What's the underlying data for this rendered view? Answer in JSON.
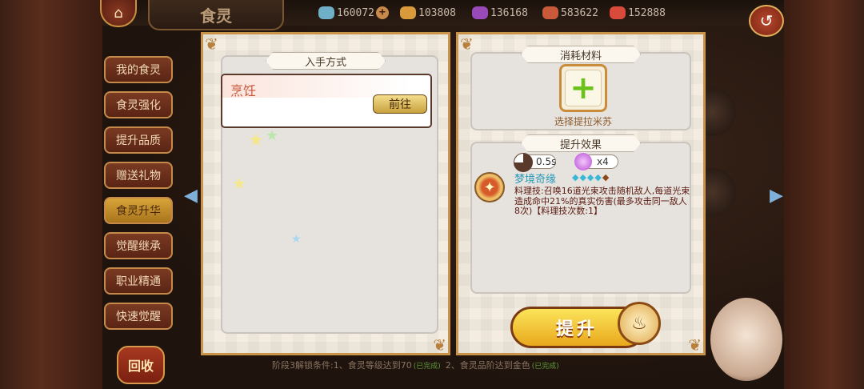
{
  "header": {
    "title": "食灵",
    "home_icon": "⌂",
    "back_icon": "↺"
  },
  "resources": [
    {
      "name": "diamond",
      "value": "160072",
      "color": "#6fb0c8",
      "has_plus": true
    },
    {
      "name": "gold",
      "value": "103808",
      "color": "#d89a3a",
      "has_plus": false
    },
    {
      "name": "crystal",
      "value": "136168",
      "color": "#9a4ab8",
      "has_plus": false
    },
    {
      "name": "meat",
      "value": "583622",
      "color": "#c85a3a",
      "has_plus": false
    },
    {
      "name": "cake",
      "value": "152888",
      "color": "#d84a3a",
      "has_plus": false
    }
  ],
  "sidebar": {
    "items": [
      {
        "label": "我的食灵"
      },
      {
        "label": "食灵强化"
      },
      {
        "label": "提升品质"
      },
      {
        "label": "赠送礼物"
      },
      {
        "label": "食灵升华"
      },
      {
        "label": "觉醒继承"
      },
      {
        "label": "职业精通"
      },
      {
        "label": "快速觉醒"
      }
    ],
    "active_index": 4,
    "recycle_label": "回收"
  },
  "left_panel": {
    "section_title": "入手方式",
    "source_name": "烹饪",
    "goto_label": "前往"
  },
  "right_panel": {
    "materials_title": "消耗材料",
    "slot_label": "选择提拉米苏",
    "effect_title": "提升效果",
    "cooldown": "0.5s",
    "energy": "x4",
    "skill_name": "梦境奇缘",
    "gems": "◆◆◆◆",
    "gem_last": "◆",
    "skill_desc": "料理技:召唤16道光束攻击随机敌人,每道光束造成命中21%的真实伤害(最多攻击同一敌人8次)【料理技次数:1】"
  },
  "upgrade_label": "提升",
  "conditions": {
    "text1": "阶段3解锁条件:1、食灵等级达到70",
    "ok1": "(已完成)",
    "text2": "2、食灵品阶达到金色",
    "ok2": "(已完成)"
  }
}
